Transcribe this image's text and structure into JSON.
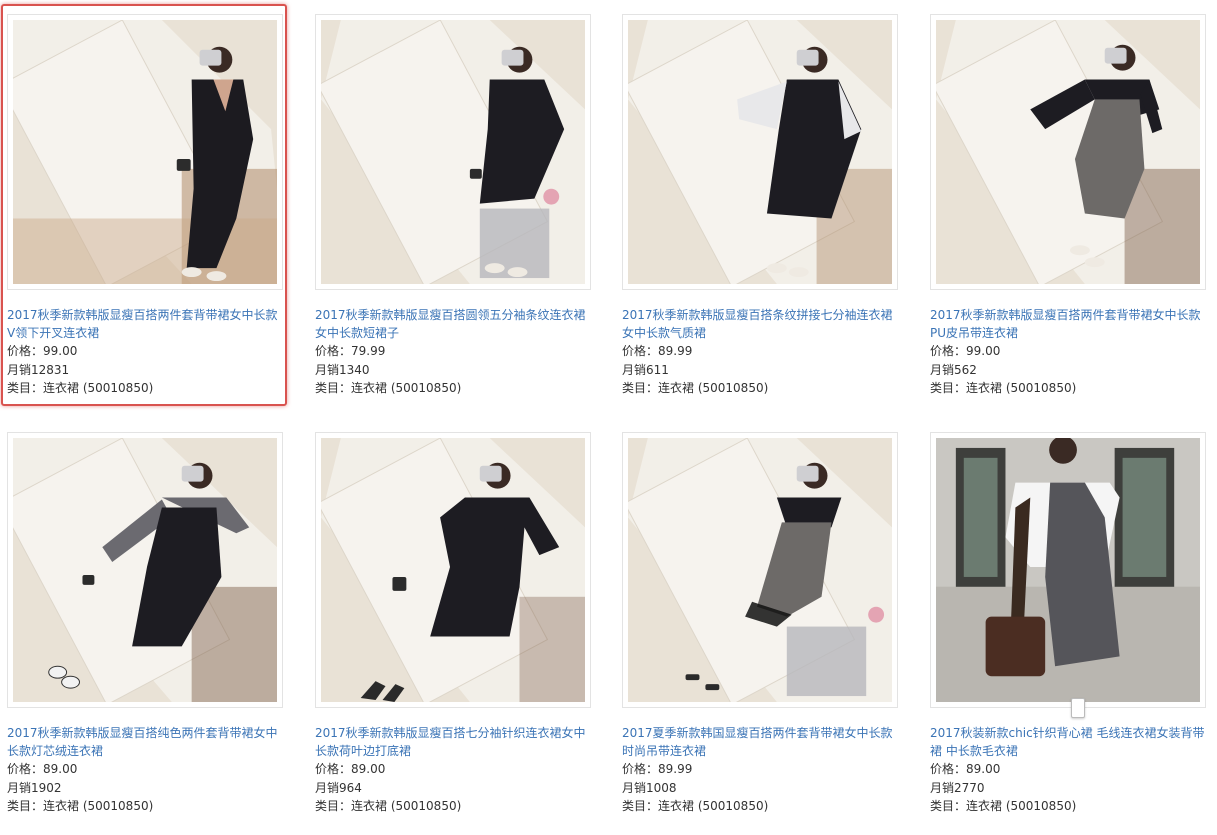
{
  "colors": {
    "link": "#3b74b6",
    "selected_outline": "#d9534f"
  },
  "labels": {
    "price_prefix": "价格：",
    "sales_prefix": "月销",
    "category_prefix": "类目："
  },
  "products": [
    {
      "title_line1": "2017秋季新款韩版显瘦百搭两件套背带裙女中长款",
      "title_line2": "V领下开叉连衣裙",
      "price": "99.00",
      "sales": "12831",
      "category": "连衣裙 (50010850)",
      "image": "model-black-vneck-jumpsuit-dress",
      "selected": true
    },
    {
      "title_line1": "2017秋季新款韩版显瘦百搭圆领五分袖条纹连衣裙",
      "title_line2": "女中长款短裙子",
      "price": "79.99",
      "sales": "1340",
      "category": "连衣裙 (50010850)",
      "image": "model-black-round-neck-dress"
    },
    {
      "title_line1": "2017秋季新款韩版显瘦百搭条纹拼接七分袖连衣裙",
      "title_line2": "女中长款气质裙",
      "price": "89.99",
      "sales": "611",
      "category": "连衣裙 (50010850)",
      "image": "model-striped-sleeve-black-dress"
    },
    {
      "title_line1": "2017秋季新款韩版显瘦百搭两件套背带裙女中长款",
      "title_line2": "PU皮吊带连衣裙",
      "price": "99.00",
      "sales": "562",
      "category": "连衣裙 (50010850)",
      "image": "model-grey-pinafore-dress"
    },
    {
      "title_line1": "2017秋季新款韩版显瘦百搭纯色两件套背带裙女中",
      "title_line2": "长款灯芯绒连衣裙",
      "price": "89.00",
      "sales": "1902",
      "category": "连衣裙 (50010850)",
      "image": "model-black-corduroy-pinafore"
    },
    {
      "title_line1": "2017秋季新款韩版显瘦百搭七分袖针织连衣裙女中",
      "title_line2": "长款荷叶边打底裙",
      "price": "89.00",
      "sales": "964",
      "category": "连衣裙 (50010850)",
      "image": "model-black-knit-ruffle-dress"
    },
    {
      "title_line1": "2017夏季新款韩国显瘦百搭两件套背带裙女中长款",
      "title_line2": "时尚吊带连衣裙",
      "price": "89.99",
      "sales": "1008",
      "category": "连衣裙 (50010850)",
      "image": "model-grey-strap-dress-lace-hem"
    },
    {
      "title_line1": "2017秋装新款chic针织背心裙 毛线连衣裙女装背带",
      "title_line2": "裙 中长款毛衣裙",
      "price": "89.00",
      "sales": "2770",
      "category": "连衣裙 (50010850)",
      "image": "model-grey-knit-vest-dress-white-blouse"
    }
  ]
}
